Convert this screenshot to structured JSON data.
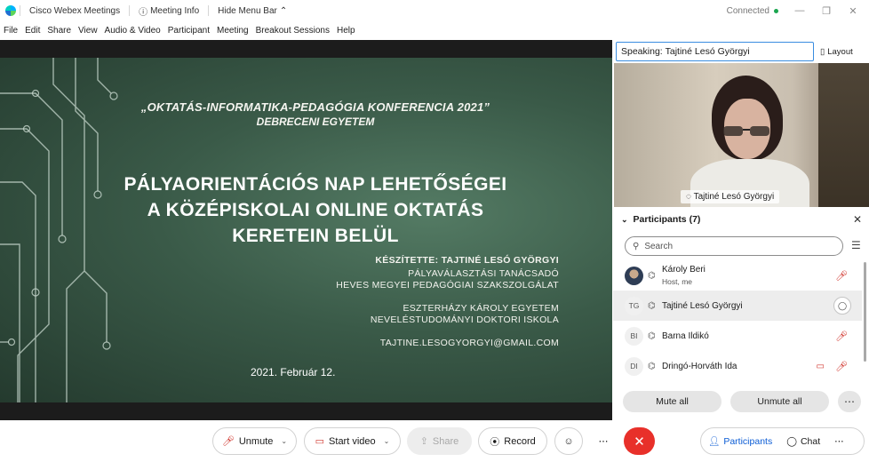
{
  "titlebar": {
    "app_name": "Cisco Webex Meetings",
    "meeting_info": "Meeting Info",
    "hide_menu": "Hide Menu Bar",
    "status": "Connected",
    "minimize": "—",
    "restore": "❐",
    "close": "✕"
  },
  "menu": [
    "File",
    "Edit",
    "Share",
    "View",
    "Audio & Video",
    "Participant",
    "Meeting",
    "Breakout Sessions",
    "Help"
  ],
  "slide": {
    "conference": "„OKTATÁS-INFORMATIKA-PEDAGÓGIA KONFERENCIA 2021”",
    "university": "DEBRECENI EGYETEM",
    "title_line1": "PÁLYAORIENTÁCIÓS NAP LEHETŐSÉGEI",
    "title_line2": "A KÖZÉPISKOLAI ONLINE OKTATÁS",
    "title_line3": "KERETEIN BELÜL",
    "author": "KÉSZÍTETTE: TAJTINÉ LESÓ GYÖRGYI",
    "role": "PÁLYAVÁLASZTÁSI TANÁCSADÓ",
    "org1": "HEVES MEGYEI PEDAGÓGIAI SZAKSZOLGÁLAT",
    "org2": "ESZTERHÁZY KÁROLY EGYETEM",
    "org3": "NEVELÉSTUDOMÁNYI DOKTORI ISKOLA",
    "email": "TAJTINE.LESOGYORGYI@GMAIL.COM",
    "date": "2021. Február 12."
  },
  "speaking": {
    "label": "Speaking:",
    "name": "Tajtiné Lesó Györgyi"
  },
  "layout_label": "Layout",
  "video_name": "Tajtiné Lesó Györgyi",
  "participants": {
    "title": "Participants (7)",
    "search_placeholder": "Search",
    "list": [
      {
        "initials": "",
        "name": "Károly Beri",
        "sub": "Host, me",
        "mic": "muted"
      },
      {
        "initials": "TG",
        "name": "Tajtiné Lesó Györgyi",
        "sub": "",
        "mic": "active"
      },
      {
        "initials": "BI",
        "name": "Barna Ildikó",
        "sub": "",
        "mic": "muted"
      },
      {
        "initials": "DI",
        "name": "Dringó-Horváth Ida",
        "sub": "",
        "mic": "muted"
      }
    ],
    "mute_all": "Mute all",
    "unmute_all": "Unmute all"
  },
  "controls": {
    "unmute": "Unmute",
    "start_video": "Start video",
    "share": "Share",
    "record": "Record",
    "participants": "Participants",
    "chat": "Chat"
  },
  "colors": {
    "end_button": "#e8302a",
    "accent_blue": "#0b5cd5",
    "muted_red": "#d0342c",
    "slide_green": "#3a5a48"
  }
}
